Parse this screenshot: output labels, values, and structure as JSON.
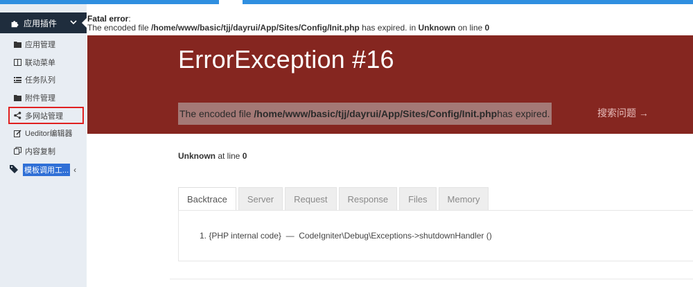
{
  "sidebar": {
    "header": {
      "label": "应用插件",
      "icon": "puzzle-icon"
    },
    "items": [
      {
        "label": "应用管理",
        "icon": "folder-icon"
      },
      {
        "label": "联动菜单",
        "icon": "columns-icon"
      },
      {
        "label": "任务队列",
        "icon": "list-icon"
      },
      {
        "label": "附件管理",
        "icon": "folder-icon"
      },
      {
        "label": "多网站管理",
        "icon": "share-icon"
      },
      {
        "label": "Ueditor编辑器",
        "icon": "edit-icon"
      },
      {
        "label": "内容复制",
        "icon": "copy-icon"
      }
    ],
    "template_item": {
      "label": "模板调用工...",
      "icon": "tag-icon",
      "arrow": "‹"
    }
  },
  "fatal": {
    "title": "Fatal error",
    "colon": ":",
    "prefix": "The encoded file ",
    "path": "/home/www/basic/tjj/dayrui/App/Sites/Config/Init.php",
    "middle": " has expired. in ",
    "unknown": "Unknown",
    "line_text": " on line ",
    "line": "0"
  },
  "banner": {
    "title": "ErrorException #16",
    "message_prefix": "The encoded file ",
    "message_path": "/home/www/basic/tjj/dayrui/App/Sites/Config/Init.php",
    "message_suffix": " has expired.",
    "search_label": "搜索问题 →"
  },
  "location": {
    "file": "Unknown",
    "at_line": " at line ",
    "line": "0"
  },
  "tabs": [
    "Backtrace",
    "Server",
    "Request",
    "Response",
    "Files",
    "Memory"
  ],
  "backtrace": [
    {
      "index": "1.",
      "origin": "{PHP internal code}",
      "sep": "—",
      "call": "CodeIgniter\\Debug\\Exceptions->shutdownHandler ()"
    }
  ],
  "colors": {
    "banner": "#852620",
    "sidebar_header": "#1f2d3d",
    "active_outline": "#e02020",
    "top_strip": "#2f8fe0"
  }
}
